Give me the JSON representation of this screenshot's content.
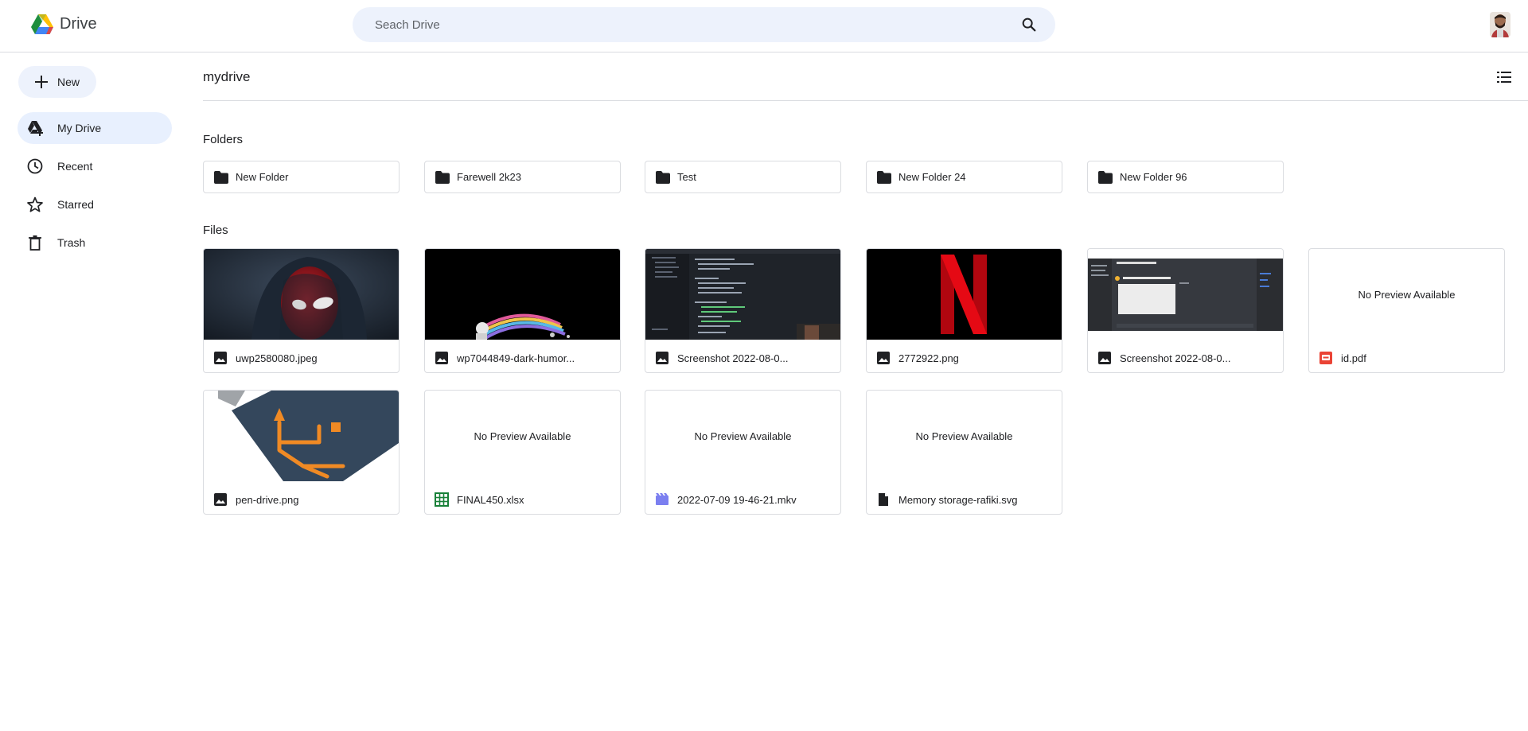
{
  "app": {
    "title": "Drive"
  },
  "search": {
    "placeholder": "Seach Drive",
    "value": ""
  },
  "sidebar": {
    "new_label": "New",
    "items": [
      {
        "label": "My Drive",
        "icon": "my-drive-icon",
        "active": true
      },
      {
        "label": "Recent",
        "icon": "clock-icon",
        "active": false
      },
      {
        "label": "Starred",
        "icon": "star-icon",
        "active": false
      },
      {
        "label": "Trash",
        "icon": "trash-icon",
        "active": false
      }
    ]
  },
  "main": {
    "title": "mydrive",
    "folders_heading": "Folders",
    "files_heading": "Files",
    "no_preview_text": "No Preview Available",
    "folders": [
      {
        "name": "New Folder"
      },
      {
        "name": "Farewell 2k23"
      },
      {
        "name": "Test"
      },
      {
        "name": "New Folder 24"
      },
      {
        "name": "New Folder 96"
      }
    ],
    "files": [
      {
        "name": "uwp2580080.jpeg",
        "icon": "image-icon",
        "preview": "spiderman-image"
      },
      {
        "name": "wp7044849-dark-humor...",
        "icon": "image-icon",
        "preview": "astronaut-rainbow-image"
      },
      {
        "name": "Screenshot 2022-08-0...",
        "icon": "image-icon",
        "preview": "code-editor-screenshot"
      },
      {
        "name": "2772922.png",
        "icon": "image-icon",
        "preview": "netflix-logo-image"
      },
      {
        "name": "Screenshot 2022-08-0...",
        "icon": "image-icon",
        "preview": "chat-app-screenshot"
      },
      {
        "name": "id.pdf",
        "icon": "pdf-icon",
        "preview": "none"
      },
      {
        "name": "pen-drive.png",
        "icon": "image-icon",
        "preview": "usb-drive-image"
      },
      {
        "name": "FINAL450.xlsx",
        "icon": "spreadsheet-icon",
        "preview": "none"
      },
      {
        "name": "2022-07-09 19-46-21.mkv",
        "icon": "video-icon",
        "preview": "none"
      },
      {
        "name": "Memory storage-rafiki.svg",
        "icon": "document-icon",
        "preview": "none"
      }
    ]
  },
  "colors": {
    "accent_bg": "#e8f0fe",
    "search_bg": "#edf2fc",
    "border": "#dadce0",
    "pdf_red": "#ea4335",
    "sheet_green": "#188038",
    "video_purple": "#7b7ff0"
  }
}
